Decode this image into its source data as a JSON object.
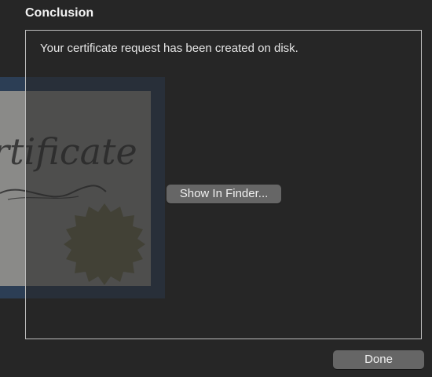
{
  "dialog": {
    "heading": "Conclusion",
    "message": "Your certificate request has been created on disk.",
    "show_in_finder_label": "Show In Finder...",
    "done_label": "Done"
  },
  "illustration": {
    "text": "rtificate"
  },
  "colors": {
    "background": "#262626",
    "button": "#666666",
    "panel_border": "#bdbdbd",
    "text": "#e6e6e6"
  }
}
